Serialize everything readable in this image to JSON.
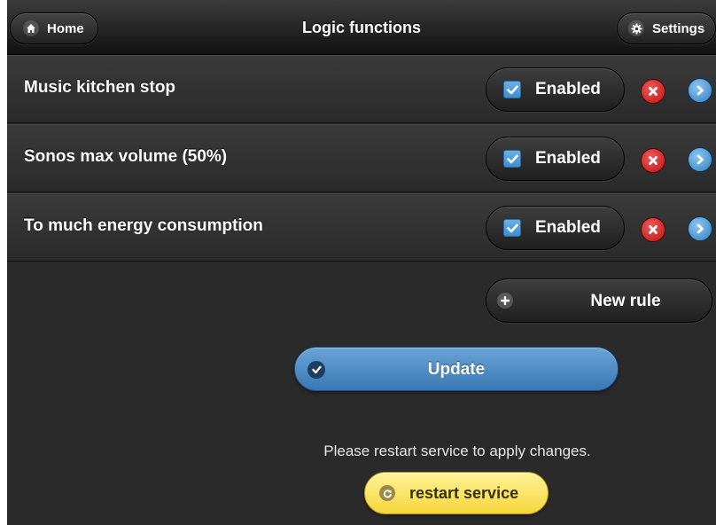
{
  "header": {
    "title": "Logic functions",
    "home_label": "Home",
    "home_icon": "home-icon",
    "settings_label": "Settings",
    "settings_icon": "gear-icon"
  },
  "rules": [
    {
      "name": "Music kitchen stop",
      "enabled": true,
      "enabled_label": "Enabled"
    },
    {
      "name": "Sonos max volume (50%)",
      "enabled": true,
      "enabled_label": "Enabled"
    },
    {
      "name": "To much energy consumption",
      "enabled": true,
      "enabled_label": "Enabled"
    }
  ],
  "actions": {
    "new_rule_label": "New rule",
    "update_label": "Update",
    "restart_message": "Please restart service to apply changes.",
    "restart_label": "restart service"
  },
  "colors": {
    "checkbox": "#3d8fd0",
    "delete": "#c41a1a",
    "navigate": "#2f7fc2",
    "update": "#4a8ac4",
    "restart": "#f5d63a"
  }
}
